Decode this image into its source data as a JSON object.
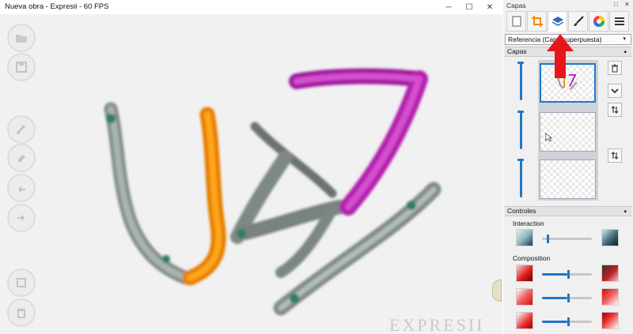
{
  "window": {
    "title": "Nueva obra - Expresii - 60 FPS",
    "minimize_glyph": "─",
    "maximize_glyph": "☐",
    "close_glyph": "✕"
  },
  "canvas": {
    "watermark": "EXPRESII",
    "stroke_colors": {
      "gray": "#8a9590",
      "orange": "#f08a00",
      "magenta": "#b51fb0",
      "teal": "#2f7d6b"
    }
  },
  "toolbar": {
    "items": [
      {
        "name": "open-icon"
      },
      {
        "name": "save-icon"
      },
      {
        "name": "brush-settings-icon"
      },
      {
        "name": "eraser-icon"
      },
      {
        "name": "undo-icon"
      },
      {
        "name": "redo-icon"
      },
      {
        "name": "layers-toggle-icon"
      },
      {
        "name": "trash-icon"
      }
    ]
  },
  "panel": {
    "title": "Capas",
    "float_glyph": "□",
    "close_glyph": "✕",
    "tabs": [
      {
        "name": "tab-paper",
        "icon": "paper-icon",
        "active": false
      },
      {
        "name": "tab-crop",
        "icon": "crop-icon",
        "active": false
      },
      {
        "name": "tab-layers",
        "icon": "layers-icon",
        "active": true
      },
      {
        "name": "tab-brush",
        "icon": "brush-icon",
        "active": false
      },
      {
        "name": "tab-color",
        "icon": "color-wheel-icon",
        "active": false
      },
      {
        "name": "tab-menu",
        "icon": "menu-icon",
        "active": false
      }
    ],
    "reference_select": {
      "value": "Referencia (Capa superpuesta)",
      "caret": "▾"
    },
    "layers_section": {
      "title": "Capas",
      "caret": "▴"
    },
    "controls_section": {
      "title": "Controles",
      "caret": "▴"
    },
    "interaction_label": "Interaction",
    "composition_label": "Composition",
    "interaction_slider_value": 0.1,
    "composition_slider_values": [
      0.5,
      0.5,
      0.5
    ],
    "accent_color": "#1e77c8",
    "highlight_arrow_color": "#e8161b"
  }
}
